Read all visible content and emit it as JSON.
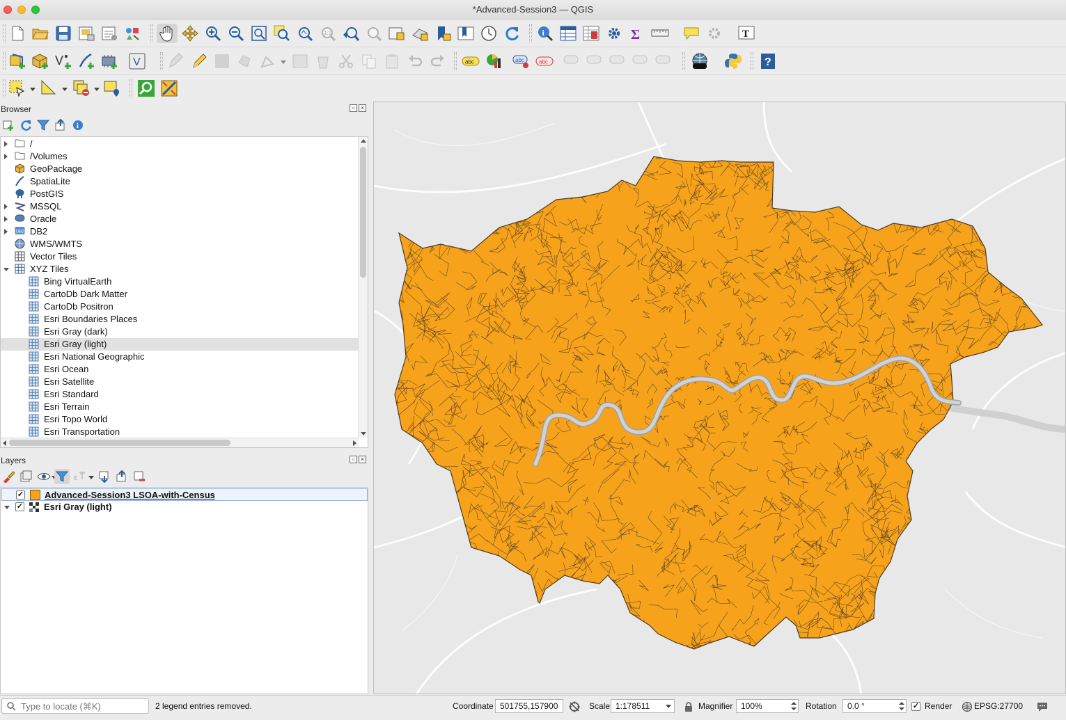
{
  "window": {
    "title": "*Advanced-Session3 — QGIS"
  },
  "colors": {
    "fill": "#f7a21b",
    "outline": "#4a3a25",
    "river": "#c8c8c8",
    "basemap": "#e6e6e6"
  },
  "icons": {
    "toolbar1": [
      "new-project-icon",
      "open-project-icon",
      "save-project-icon",
      "print-layout-icon",
      "layout-manager-icon",
      "style-manager-icon",
      "pan-icon",
      "pan-to-selection-icon",
      "zoom-in-icon",
      "zoom-out-icon",
      "zoom-full-icon",
      "zoom-to-selection-icon",
      "zoom-to-layer-icon",
      "zoom-native-icon",
      "zoom-last-icon",
      "zoom-next-icon",
      "new-map-view-icon",
      "new-3d-map-view-icon",
      "bookmark-icon",
      "show-bookmarks-icon",
      "temporal-controller-icon",
      "refresh-icon",
      "identify-icon",
      "attribute-table-icon",
      "field-calculator-icon",
      "processing-toolbox-icon",
      "statistics-icon",
      "measure-icon",
      "map-tips-icon",
      "annotation-icon",
      "text-annotation-icon"
    ],
    "toolbar2": [
      "data-source-manager-icon",
      "new-geopackage-icon",
      "new-shapefile-icon",
      "new-spatialite-icon",
      "new-temporary-layer-icon",
      "new-virtual-layer-icon",
      "current-edits-icon",
      "toggle-editing-icon",
      "save-edits-icon",
      "add-feature-icon",
      "vertex-tool-icon",
      "modify-attributes-icon",
      "delete-selected-icon",
      "cut-features-icon",
      "copy-features-icon",
      "paste-features-icon",
      "undo-icon",
      "redo-icon",
      "layer-labeling-icon",
      "layer-diagram-icon",
      "highlight-pinned-labels-icon",
      "pin-labels-icon",
      "show-hide-labels-icon",
      "move-label-icon",
      "rotate-label-icon",
      "change-label-icon",
      "label-tool-icon",
      "plugin-globe-icon",
      "python-console-icon",
      "help-icon"
    ],
    "toolbar3": [
      "select-features-icon",
      "select-by-value-icon",
      "deselect-icon",
      "select-location-icon",
      "locator-icon",
      "plugin-icon"
    ]
  },
  "browser": {
    "title": "Browser",
    "items": [
      {
        "label": "/",
        "icon": "folder-icon",
        "expander": "collapsed",
        "indent": 0
      },
      {
        "label": "/Volumes",
        "icon": "folder-icon",
        "expander": "collapsed",
        "indent": 0
      },
      {
        "label": "GeoPackage",
        "icon": "geopackage-icon",
        "expander": "none",
        "indent": 0
      },
      {
        "label": "SpatiaLite",
        "icon": "spatialite-icon",
        "expander": "none",
        "indent": 0
      },
      {
        "label": "PostGIS",
        "icon": "postgis-icon",
        "expander": "none",
        "indent": 0
      },
      {
        "label": "MSSQL",
        "icon": "mssql-icon",
        "expander": "collapsed",
        "indent": 0
      },
      {
        "label": "Oracle",
        "icon": "oracle-icon",
        "expander": "collapsed",
        "indent": 0
      },
      {
        "label": "DB2",
        "icon": "db2-icon",
        "expander": "collapsed",
        "indent": 0
      },
      {
        "label": "WMS/WMTS",
        "icon": "wms-icon",
        "expander": "none",
        "indent": 0
      },
      {
        "label": "Vector Tiles",
        "icon": "vector-tiles-icon",
        "expander": "none",
        "indent": 0
      },
      {
        "label": "XYZ Tiles",
        "icon": "xyz-tiles-icon",
        "expander": "expanded",
        "indent": 0
      },
      {
        "label": "Bing VirtualEarth",
        "icon": "tile-grid-icon",
        "expander": "none",
        "indent": 1
      },
      {
        "label": "CartoDb Dark Matter",
        "icon": "tile-grid-icon",
        "expander": "none",
        "indent": 1
      },
      {
        "label": "CartoDb Positron",
        "icon": "tile-grid-icon",
        "expander": "none",
        "indent": 1
      },
      {
        "label": "Esri Boundaries Places",
        "icon": "tile-grid-icon",
        "expander": "none",
        "indent": 1
      },
      {
        "label": "Esri Gray (dark)",
        "icon": "tile-grid-icon",
        "expander": "none",
        "indent": 1
      },
      {
        "label": "Esri Gray (light)",
        "icon": "tile-grid-icon",
        "expander": "none",
        "indent": 1,
        "selected": true
      },
      {
        "label": "Esri National Geographic",
        "icon": "tile-grid-icon",
        "expander": "none",
        "indent": 1
      },
      {
        "label": "Esri Ocean",
        "icon": "tile-grid-icon",
        "expander": "none",
        "indent": 1
      },
      {
        "label": "Esri Satellite",
        "icon": "tile-grid-icon",
        "expander": "none",
        "indent": 1
      },
      {
        "label": "Esri Standard",
        "icon": "tile-grid-icon",
        "expander": "none",
        "indent": 1
      },
      {
        "label": "Esri Terrain",
        "icon": "tile-grid-icon",
        "expander": "none",
        "indent": 1
      },
      {
        "label": "Esri Topo World",
        "icon": "tile-grid-icon",
        "expander": "none",
        "indent": 1
      },
      {
        "label": "Esri Transportation",
        "icon": "tile-grid-icon",
        "expander": "none",
        "indent": 1
      }
    ]
  },
  "layers": {
    "title": "Layers",
    "items": [
      {
        "label": "Advanced-Session3 LSOA-with-Census",
        "checked": true,
        "selected": true
      },
      {
        "label": "Esri Gray (light)",
        "checked": true,
        "selected": false
      }
    ]
  },
  "status": {
    "locate_placeholder": "Type to locate (⌘K)",
    "message": "2 legend entries removed.",
    "coordinate_label": "Coordinate",
    "coordinate": "501755,157900",
    "scale_label": "Scale",
    "scale": "1:178511",
    "magnifier_label": "Magnifier",
    "magnifier": "100%",
    "rotation_label": "Rotation",
    "rotation": "0.0 °",
    "render_label": "Render",
    "render_checked": true,
    "crs": "EPSG:27700"
  }
}
